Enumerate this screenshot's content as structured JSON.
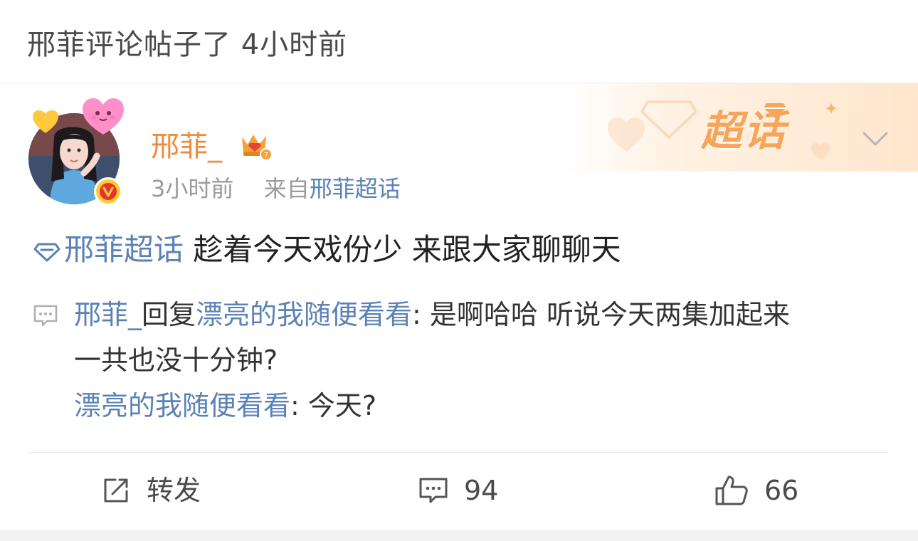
{
  "header": {
    "activity_text": "邢菲评论帖子了 4小时前"
  },
  "post": {
    "banner_text": "超话",
    "author": "邢菲_",
    "time": "3小时前",
    "from_prefix": "来自",
    "from_source": "邢菲超话",
    "topic": "邢菲超话",
    "body": " 趁着今天戏份少 来跟大家聊聊天",
    "icons": {
      "avatar": "user-avatar",
      "crown": "crown-badge-icon",
      "verified": "vip-badge-icon",
      "topic": "diamond-topic-icon",
      "more": "chevron-down-icon"
    }
  },
  "comments": [
    {
      "user": "邢菲_",
      "action": "回复",
      "reply_to": "漂亮的我随便看看",
      "text_line1": ": 是啊哈哈 听说今天两集加起来",
      "text_line2": "一共也没十分钟?"
    },
    {
      "user": "漂亮的我随便看看",
      "text": ": 今天?"
    }
  ],
  "actions": {
    "repost_label": "转发",
    "comment_count": "94",
    "like_count": "66"
  },
  "colors": {
    "link_blue": "#5b82b6",
    "author_orange": "#f08a3c",
    "banner_orange": "#f7a55a"
  }
}
